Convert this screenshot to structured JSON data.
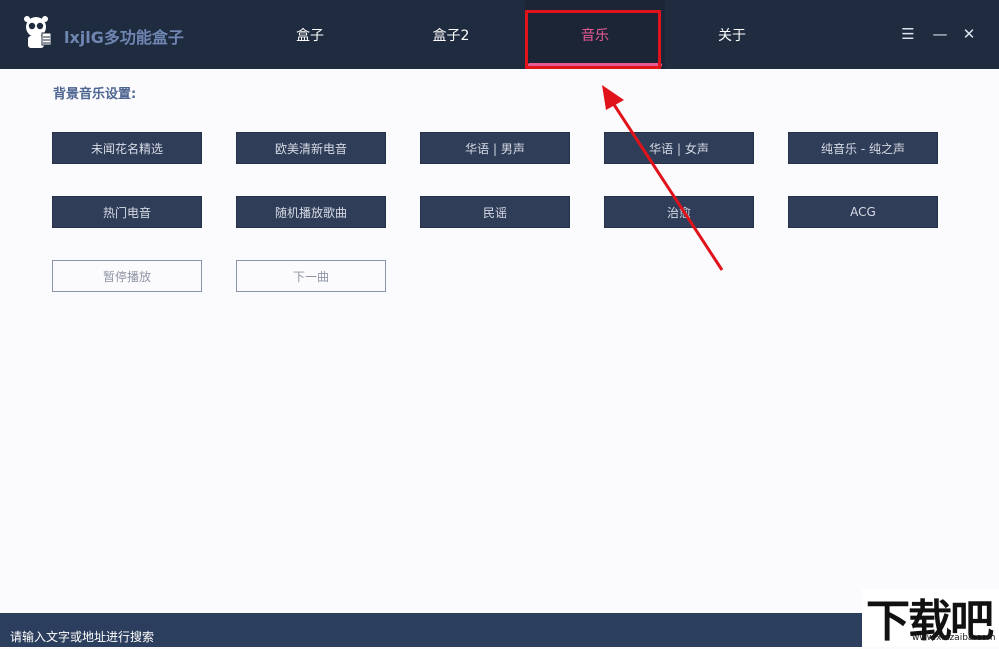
{
  "app": {
    "title": "lxjlG多功能盒子",
    "logo_icon": "panda-mascot-icon"
  },
  "tabs": [
    {
      "label": "盒子",
      "active": false
    },
    {
      "label": "盒子2",
      "active": false
    },
    {
      "label": "音乐",
      "active": true
    },
    {
      "label": "关于",
      "active": false
    }
  ],
  "window_controls": {
    "menu": "☰",
    "minimize": "—",
    "close": "✕"
  },
  "music": {
    "section_label": "背景音乐设置:",
    "row1": [
      "未闻花名精选",
      "欧美清新电音",
      "华语 | 男声",
      "华语 | 女声",
      "纯音乐 - 纯之声"
    ],
    "row2": [
      "热门电音",
      "随机播放歌曲",
      "民谣",
      "治愈",
      "ACG"
    ],
    "controls": [
      "暂停播放",
      "下一曲"
    ]
  },
  "statusbar": {
    "search_hint": "请输入文字或地址进行搜索"
  },
  "watermark": {
    "brand": "下载吧",
    "url": "www.xiazaiba.com"
  },
  "colors": {
    "titlebar": "#1f2b3e",
    "accent": "#e85a91",
    "annotation": "#e0131a",
    "button_dark": "#2f3d58",
    "bottombar": "#2c3e5d"
  }
}
